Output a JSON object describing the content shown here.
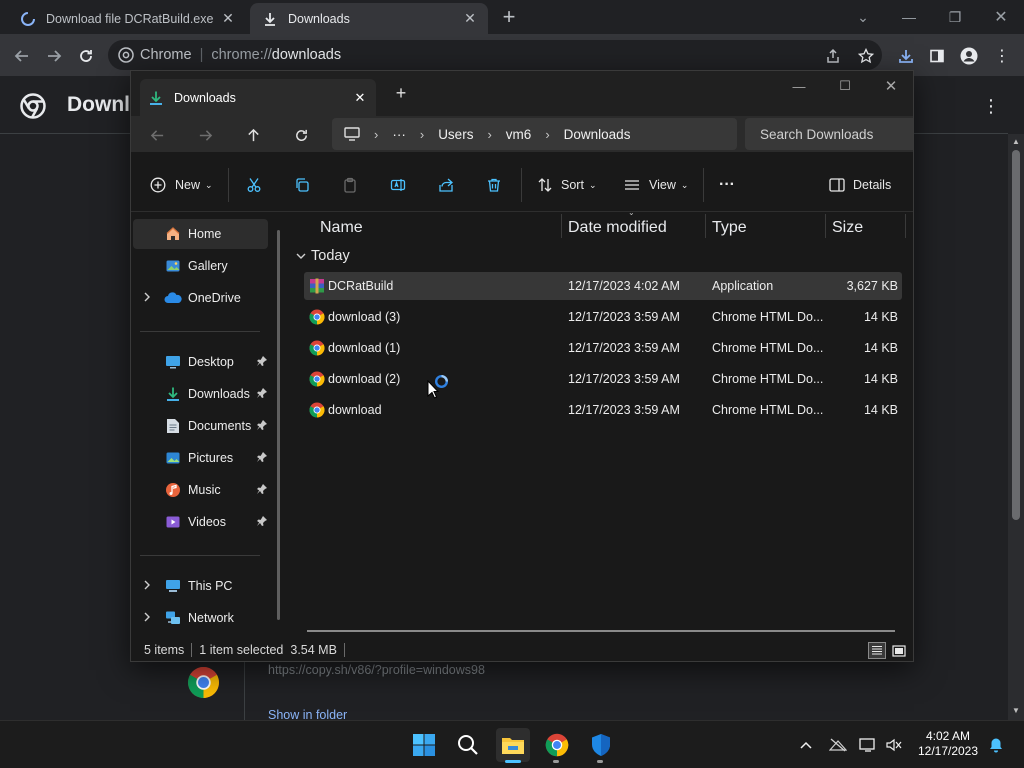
{
  "chrome": {
    "tabs": [
      {
        "title": "Download file DCRatBuild.exe on"
      },
      {
        "title": "Downloads"
      }
    ],
    "omnibox": {
      "site": "Chrome",
      "scheme": "chrome://",
      "path": "downloads"
    }
  },
  "downloads_page": {
    "title": "Downloads",
    "item_url": "https://copy.sh/v86/?profile=windows98",
    "show_in_folder": "Show in folder"
  },
  "explorer": {
    "tab_title": "Downloads",
    "breadcrumb": [
      "Users",
      "vm6",
      "Downloads"
    ],
    "breadcrumb_more": "···",
    "search_placeholder": "Search Downloads",
    "commands": {
      "new": "New",
      "sort": "Sort",
      "view": "View",
      "more": "···",
      "details": "Details"
    },
    "nav": {
      "home": "Home",
      "gallery": "Gallery",
      "onedrive": "OneDrive",
      "desktop": "Desktop",
      "downloads": "Downloads",
      "documents": "Documents",
      "pictures": "Pictures",
      "music": "Music",
      "videos": "Videos",
      "thispc": "This PC",
      "network": "Network"
    },
    "columns": {
      "name": "Name",
      "date": "Date modified",
      "type": "Type",
      "size": "Size"
    },
    "group": "Today",
    "files": [
      {
        "name": "DCRatBuild",
        "date": "12/17/2023 4:02 AM",
        "type": "Application",
        "size": "3,627 KB",
        "icon": "winrar-icon"
      },
      {
        "name": "download (3)",
        "date": "12/17/2023 3:59 AM",
        "type": "Chrome HTML Do...",
        "size": "14 KB",
        "icon": "chrome-icon"
      },
      {
        "name": "download (1)",
        "date": "12/17/2023 3:59 AM",
        "type": "Chrome HTML Do...",
        "size": "14 KB",
        "icon": "chrome-icon"
      },
      {
        "name": "download (2)",
        "date": "12/17/2023 3:59 AM",
        "type": "Chrome HTML Do...",
        "size": "14 KB",
        "icon": "chrome-icon"
      },
      {
        "name": "download",
        "date": "12/17/2023 3:59 AM",
        "type": "Chrome HTML Do...",
        "size": "14 KB",
        "icon": "chrome-icon"
      }
    ],
    "status": {
      "count": "5 items",
      "selection": "1 item selected",
      "size": "3.54 MB"
    }
  },
  "taskbar": {
    "time": "4:02 AM",
    "date": "12/17/2023"
  },
  "colors": {
    "accent": "#4cc2ff",
    "chrome_bg": "#202124",
    "explorer_bg": "#191919"
  }
}
